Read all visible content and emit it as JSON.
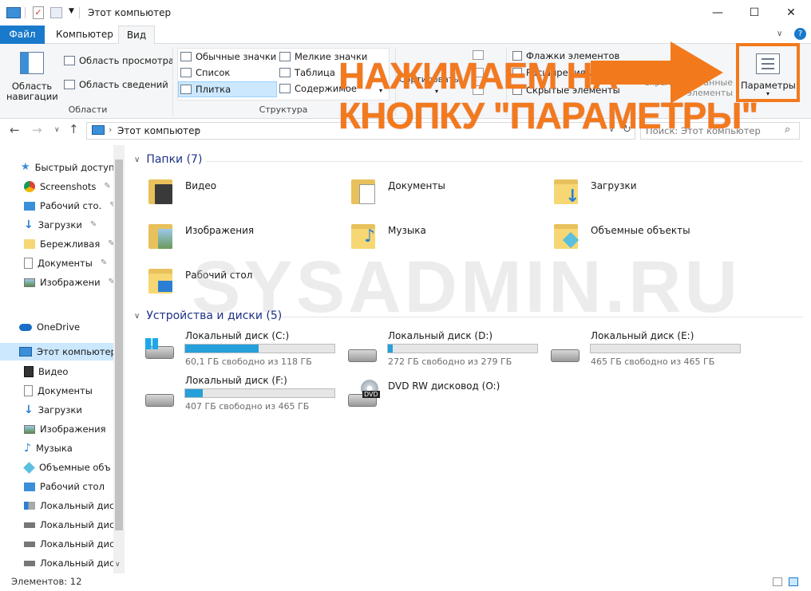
{
  "window": {
    "title": "Этот компьютер",
    "minimize": "—",
    "maximize": "☐",
    "close": "✕"
  },
  "tabs": {
    "file": "Файл",
    "computer": "Компьютер",
    "view": "Вид"
  },
  "ribbon": {
    "nav_pane": "Область навигации",
    "preview_pane": "Область просмотра",
    "details_pane": "Область сведений",
    "areas_group": "Области",
    "large_icons": "Обычные значки",
    "small_icons": "Мелкие значки",
    "list": "Список",
    "table": "Таблица",
    "tile": "Плитка",
    "content": "Содержимое",
    "structure_group": "Структура",
    "sort": "Сортировать",
    "checkboxes": "Флажки элементов",
    "extensions": "Расширения имён файлов",
    "hidden_items": "Скрытые элементы",
    "hide_selected_1": "Скрыть выбранные",
    "hide_selected_2": "элементы",
    "params": "Параметры"
  },
  "address": {
    "path": "Этот компьютер",
    "search_placeholder": "Поиск: Этот компьютер"
  },
  "nav": {
    "quick_access": "Быстрый доступ",
    "items": [
      "Screenshots",
      "Рабочий сто.",
      "Загрузки",
      "Бережливая",
      "Документы",
      "Изображени"
    ],
    "onedrive": "OneDrive",
    "this_pc": "Этот компьютер",
    "pc_items": [
      "Видео",
      "Документы",
      "Загрузки",
      "Изображения",
      "Музыка",
      "Объемные объ",
      "Рабочий стол",
      "Локальный дис",
      "Локальный дис",
      "Локальный дис",
      "Локальный дис"
    ]
  },
  "content": {
    "folders_header": "Папки (7)",
    "folders": [
      "Видео",
      "Документы",
      "Загрузки",
      "Изображения",
      "Музыка",
      "Объемные объекты",
      "Рабочий стол"
    ],
    "devices_header": "Устройства и диски (5)",
    "disks": [
      {
        "name": "Локальный диск (C:)",
        "free": "60,1 ГБ свободно из 118 ГБ",
        "used": 0.49
      },
      {
        "name": "Локальный диск (D:)",
        "free": "272 ГБ свободно из 279 ГБ",
        "used": 0.03
      },
      {
        "name": "Локальный диск (E:)",
        "free": "465 ГБ свободно из 465 ГБ",
        "used": 0.0
      },
      {
        "name": "Локальный диск (F:)",
        "free": "407 ГБ свободно из 465 ГБ",
        "used": 0.12
      }
    ],
    "dvd": {
      "name": "DVD RW дисковод (O:)",
      "badge": "DVD"
    }
  },
  "overlay": {
    "line1": "НАЖИМАЕМ НА",
    "line2": "КНОПКУ \"ПАРАМЕТРЫ\"",
    "watermark": "SYSADMIN.RU"
  },
  "status": {
    "items": "Элементов: 12"
  },
  "colors": {
    "accent": "#1979ca",
    "annotation": "#f27a1d",
    "selection": "#cce8ff",
    "disk_fill": "#26a0da"
  }
}
